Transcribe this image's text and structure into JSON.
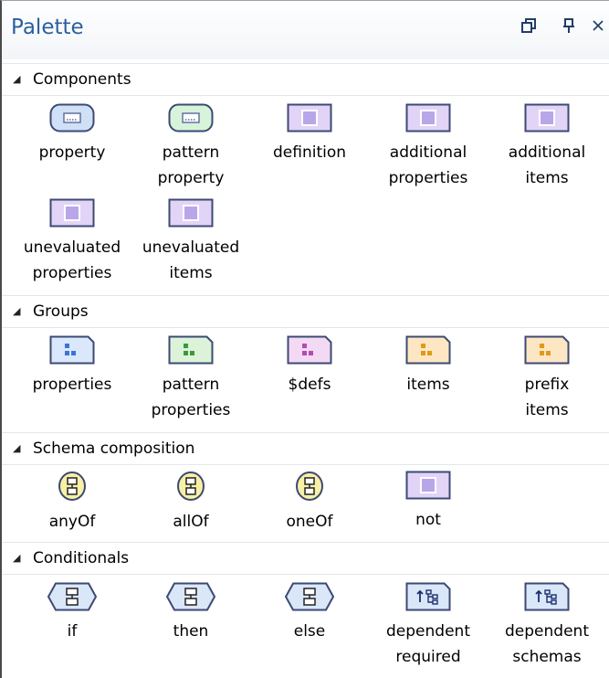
{
  "panel": {
    "title": "Palette",
    "buttons": [
      {
        "name": "restore-window-button",
        "glyph": "❐"
      },
      {
        "name": "pin-button",
        "glyph": "⊥"
      },
      {
        "name": "close-button",
        "glyph": "×"
      }
    ]
  },
  "sections": [
    {
      "label": "Components",
      "items": [
        {
          "label": "property",
          "icon": "property-field-icon"
        },
        {
          "label": "pattern\nproperty",
          "icon": "pattern-property-field-icon"
        },
        {
          "label": "definition",
          "icon": "definition-box-icon"
        },
        {
          "label": "additional\nproperties",
          "icon": "additional-properties-box-icon"
        },
        {
          "label": "additional\nitems",
          "icon": "additional-items-box-icon"
        },
        {
          "label": "unevaluated\nproperties",
          "icon": "unevaluated-properties-box-icon"
        },
        {
          "label": "unevaluated\nitems",
          "icon": "unevaluated-items-box-icon"
        }
      ]
    },
    {
      "label": "Groups",
      "items": [
        {
          "label": "properties",
          "icon": "properties-group-icon"
        },
        {
          "label": "pattern\nproperties",
          "icon": "pattern-properties-group-icon"
        },
        {
          "label": "$defs",
          "icon": "defs-group-icon"
        },
        {
          "label": "items",
          "icon": "items-group-icon"
        },
        {
          "label": "prefix\nitems",
          "icon": "prefix-items-group-icon"
        }
      ]
    },
    {
      "label": "Schema composition",
      "items": [
        {
          "label": "anyOf",
          "icon": "anyof-icon"
        },
        {
          "label": "allOf",
          "icon": "allof-icon"
        },
        {
          "label": "oneOf",
          "icon": "oneof-icon"
        },
        {
          "label": "not",
          "icon": "not-box-icon"
        }
      ]
    },
    {
      "label": "Conditionals",
      "items": [
        {
          "label": "if",
          "icon": "if-icon"
        },
        {
          "label": "then",
          "icon": "then-icon"
        },
        {
          "label": "else",
          "icon": "else-icon"
        },
        {
          "label": "dependent\nrequired",
          "icon": "dependent-required-icon"
        },
        {
          "label": "dependent\nschemas",
          "icon": "dependent-schemas-icon"
        }
      ]
    }
  ],
  "colors": {
    "title": "#2b5f9e",
    "field_blue": "#cfe0f7",
    "field_green": "#d7f3da",
    "box_violet": "#e2d4f7",
    "group_blue": "#dbe8fb",
    "group_green": "#dcf3da",
    "group_pink": "#f3d9f3",
    "group_orange": "#fde6c3",
    "composition_yellow": "#f8f0a6",
    "conditional_blue": "#d9e7f8"
  }
}
